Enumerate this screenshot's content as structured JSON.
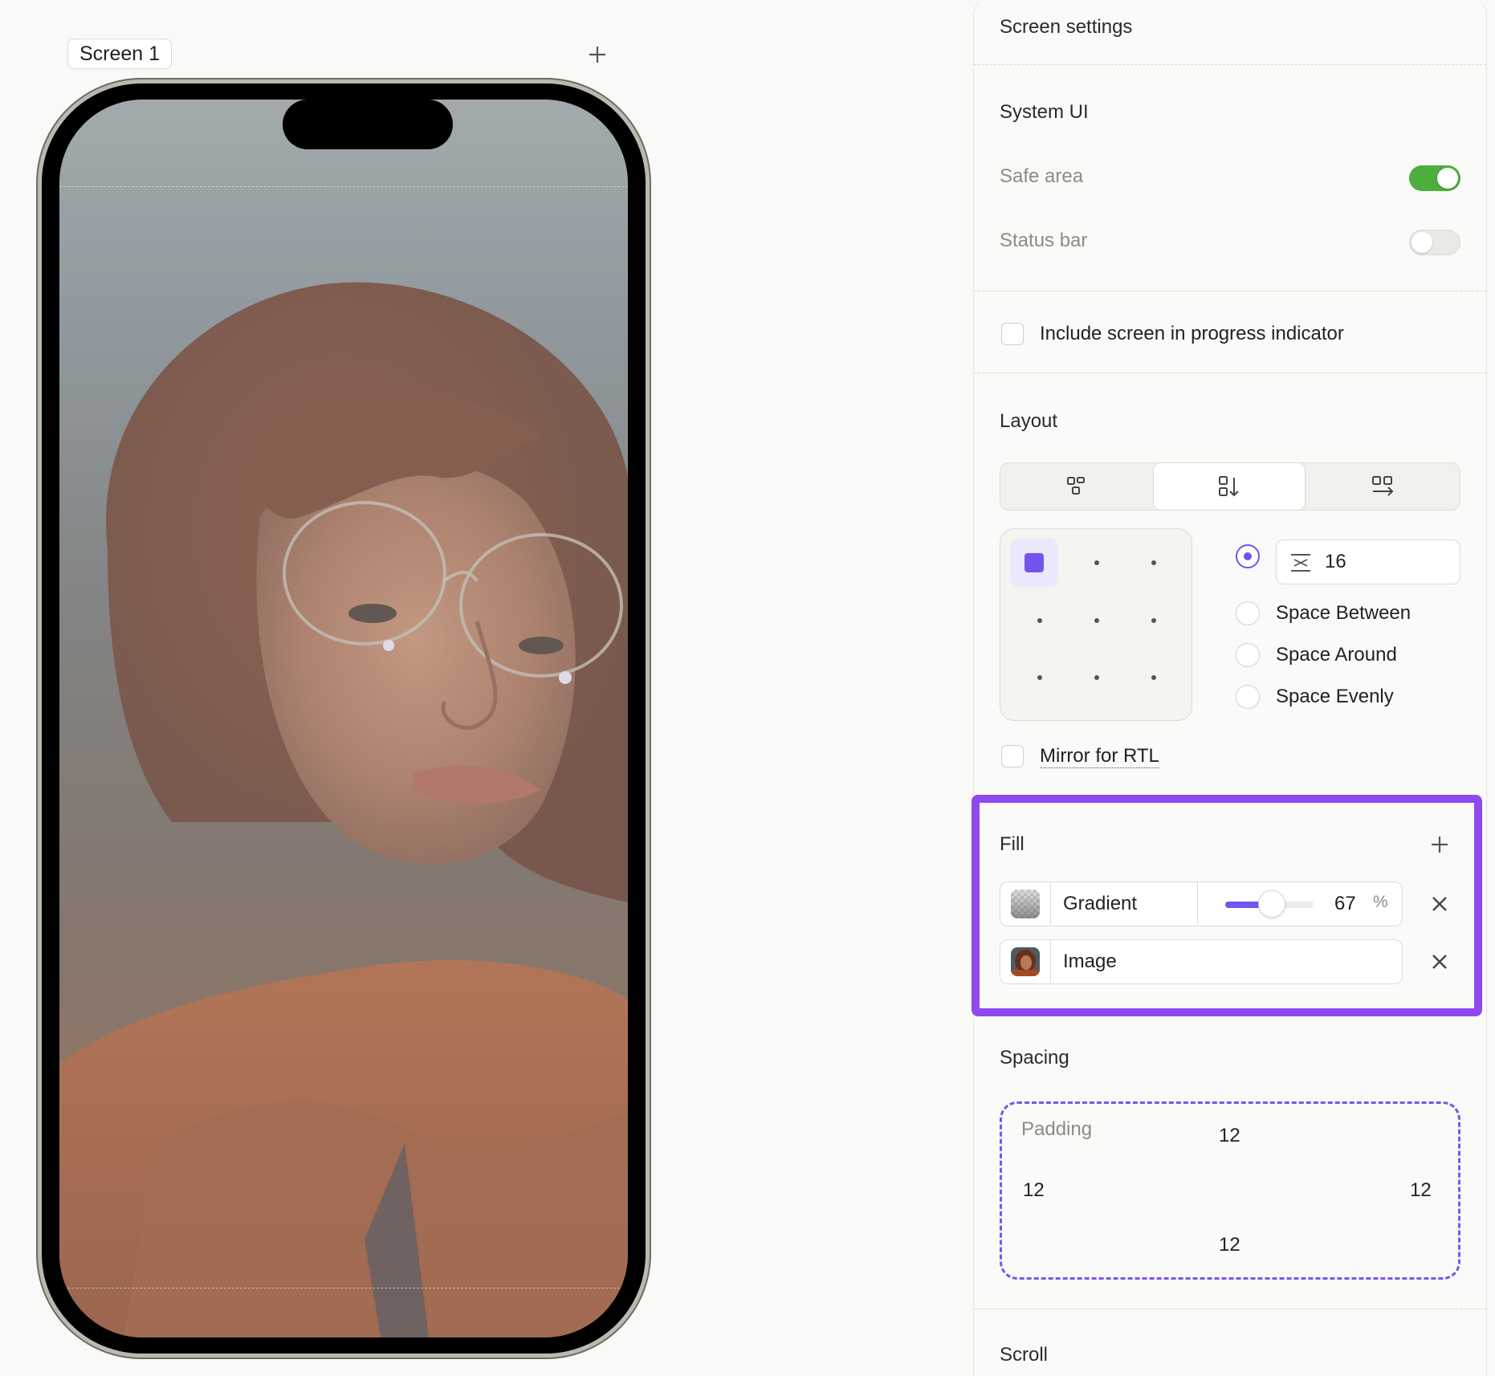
{
  "canvas": {
    "screen_tab_label": "Screen 1",
    "add_screen_icon": "plus-icon"
  },
  "panel": {
    "title": "Screen settings",
    "system_ui": {
      "heading": "System UI",
      "safe_area_label": "Safe area",
      "safe_area_on": true,
      "status_bar_label": "Status bar",
      "status_bar_on": false
    },
    "progress_indicator": {
      "label": "Include screen in progress indicator",
      "checked": false
    },
    "layout": {
      "heading": "Layout",
      "modes": [
        {
          "icon": "layout-free-icon",
          "active": false
        },
        {
          "icon": "layout-vertical-icon",
          "active": true
        },
        {
          "icon": "layout-horizontal-icon",
          "active": false
        }
      ],
      "alignment_selected": "top-left",
      "gap_value": "16",
      "distribution_options": [
        "Space Between",
        "Space Around",
        "Space Evenly"
      ],
      "mirror_label": "Mirror for RTL"
    },
    "fill": {
      "heading": "Fill",
      "items": [
        {
          "label": "Gradient",
          "opacity": "67",
          "opacity_unit": "%"
        },
        {
          "label": "Image"
        }
      ]
    },
    "spacing": {
      "heading": "Spacing",
      "padding_label": "Padding",
      "top": "12",
      "left": "12",
      "right": "12",
      "bottom": "12"
    },
    "scroll": {
      "heading": "Scroll"
    }
  },
  "colors": {
    "accent": "#7454ee",
    "highlight": "#8f49ee",
    "toggle_on": "#4caf3c"
  }
}
